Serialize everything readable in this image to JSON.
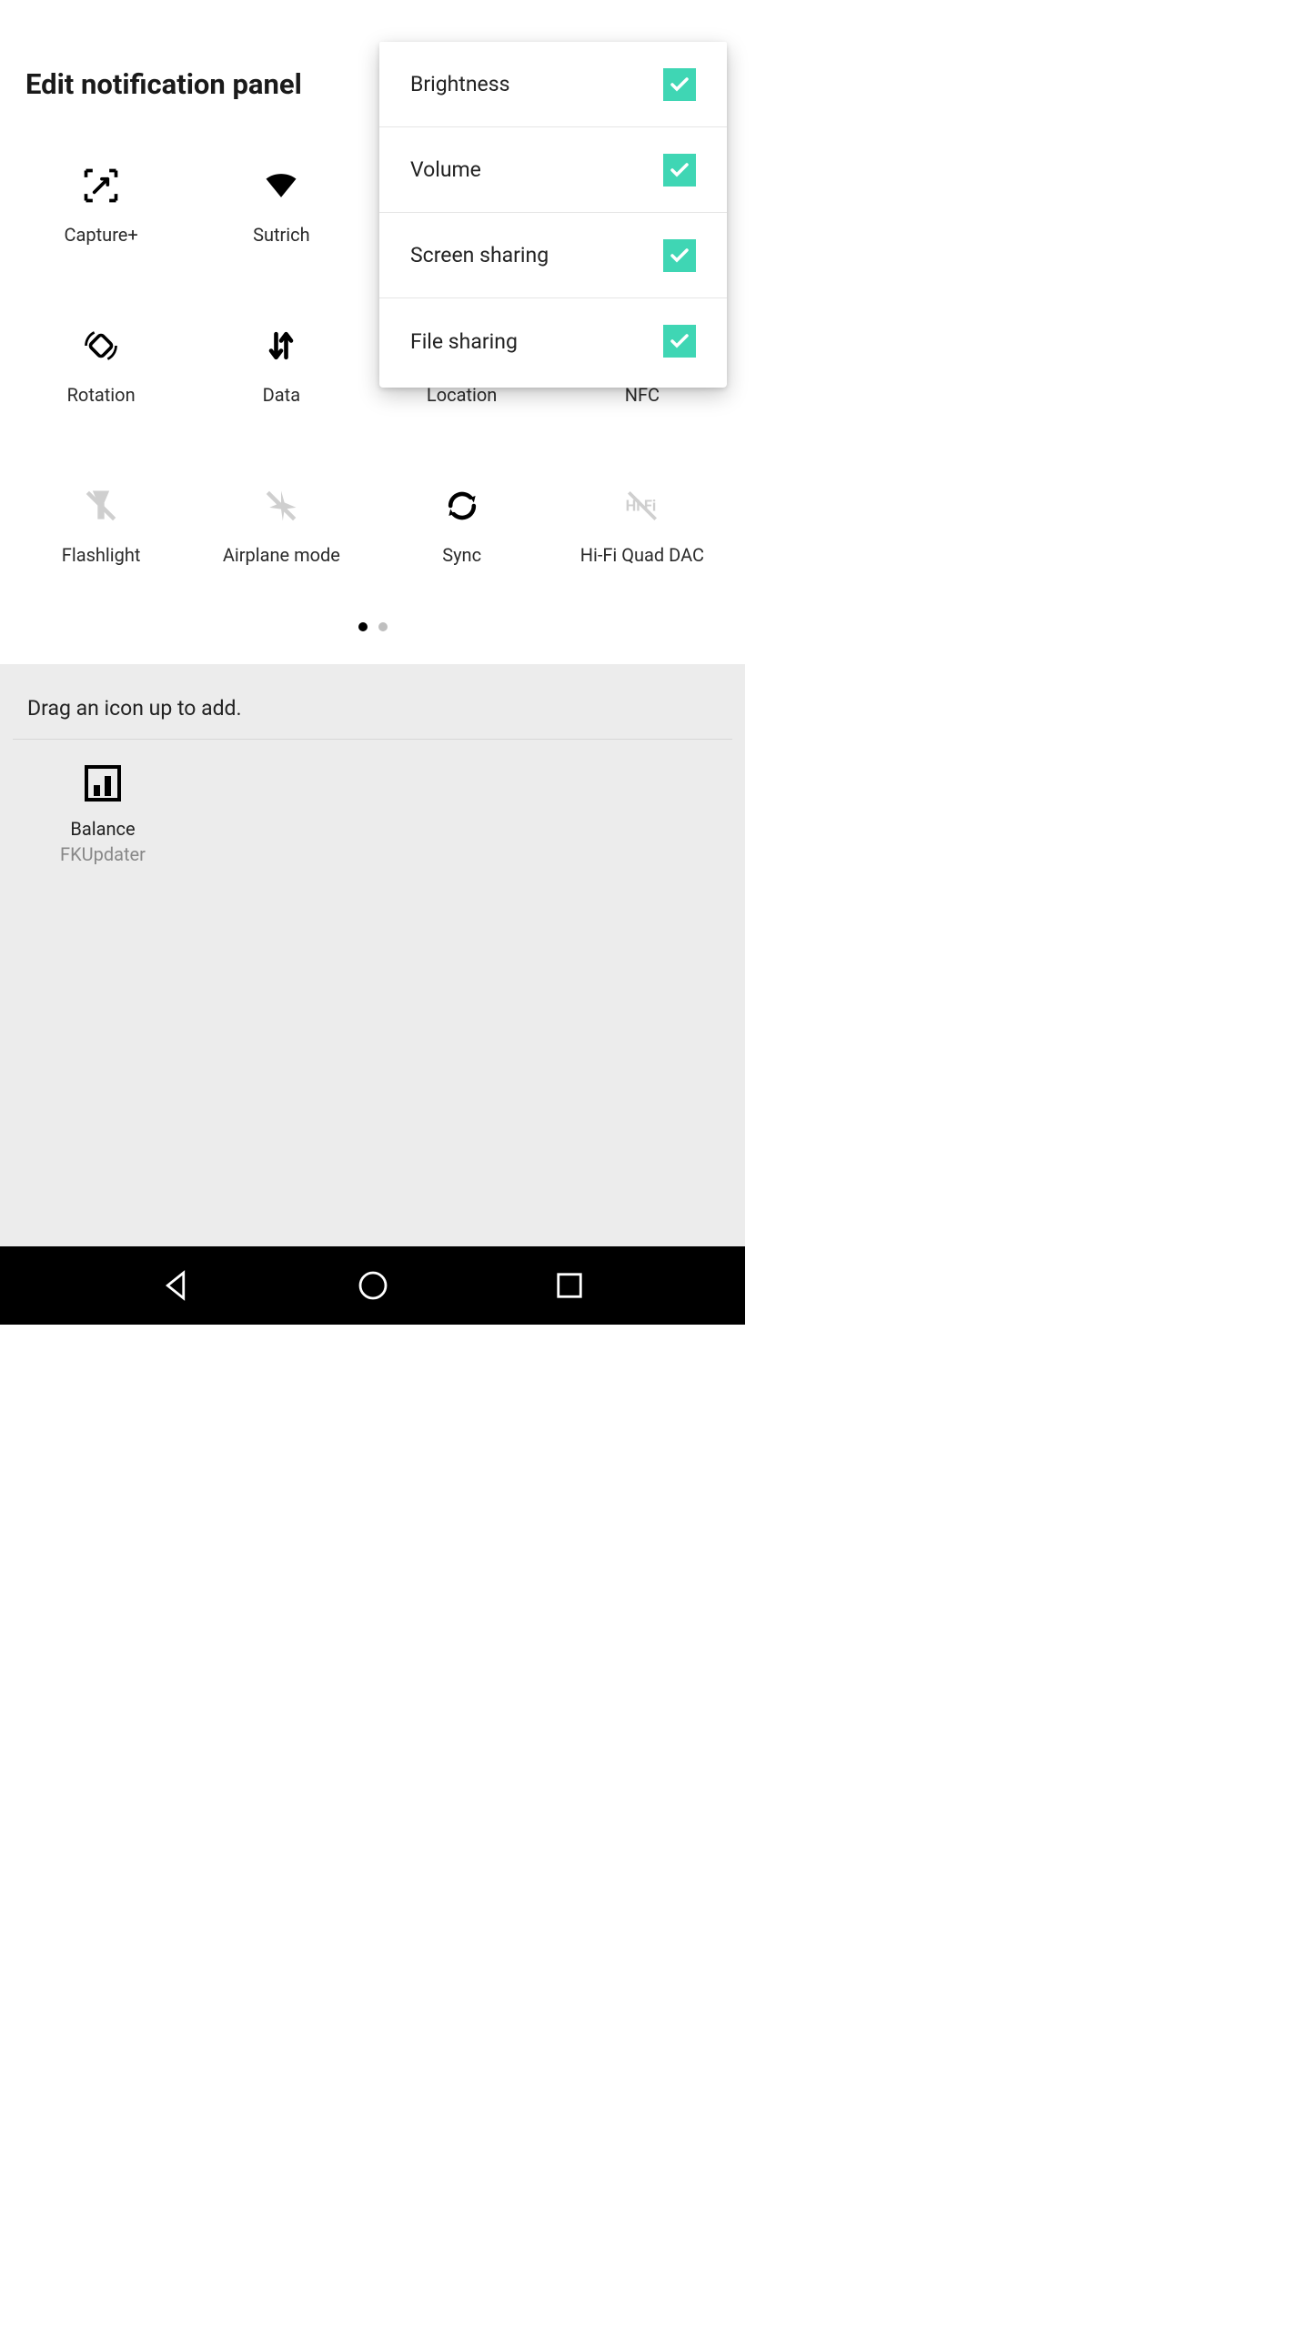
{
  "title": "Edit notification panel",
  "accent": "#3fd6b4",
  "grid": {
    "rows": [
      {
        "tiles": [
          {
            "name": "capture-plus",
            "label": "Capture+",
            "icon": "capture",
            "disabled": false
          },
          {
            "name": "wifi",
            "label": "Sutrich",
            "icon": "wifi",
            "disabled": false
          },
          {
            "name": "bluetooth",
            "label": "",
            "icon": "",
            "disabled": false
          },
          {
            "name": "sound",
            "label": "",
            "icon": "",
            "disabled": false
          }
        ]
      },
      {
        "tiles": [
          {
            "name": "rotation",
            "label": "Rotation",
            "icon": "rotation",
            "disabled": false
          },
          {
            "name": "data",
            "label": "Data",
            "icon": "data",
            "disabled": false
          },
          {
            "name": "location",
            "label": "Location",
            "icon": "location",
            "disabled": false
          },
          {
            "name": "nfc",
            "label": "NFC",
            "icon": "nfc",
            "disabled": false
          }
        ]
      },
      {
        "tiles": [
          {
            "name": "flashlight",
            "label": "Flashlight",
            "icon": "flashlight",
            "disabled": true
          },
          {
            "name": "airplane",
            "label": "Airplane mode",
            "icon": "airplane",
            "disabled": true
          },
          {
            "name": "sync",
            "label": "Sync",
            "icon": "sync",
            "disabled": false
          },
          {
            "name": "hifi",
            "label": "Hi-Fi Quad DAC",
            "icon": "hifi",
            "disabled": true
          }
        ]
      }
    ]
  },
  "pager": {
    "count": 2,
    "active": 0
  },
  "tray": {
    "caption": "Drag an icon up to add.",
    "tiles": [
      {
        "name": "balance",
        "label1": "Balance",
        "label2": "FKUpdater",
        "icon": "balance"
      }
    ]
  },
  "dropdown": {
    "items": [
      {
        "name": "brightness",
        "label": "Brightness",
        "checked": true
      },
      {
        "name": "volume",
        "label": "Volume",
        "checked": true
      },
      {
        "name": "screen-sharing",
        "label": "Screen sharing",
        "checked": true
      },
      {
        "name": "file-sharing",
        "label": "File sharing",
        "checked": true
      }
    ]
  },
  "navbar": {
    "back": "back",
    "home": "home",
    "recent": "recent"
  }
}
